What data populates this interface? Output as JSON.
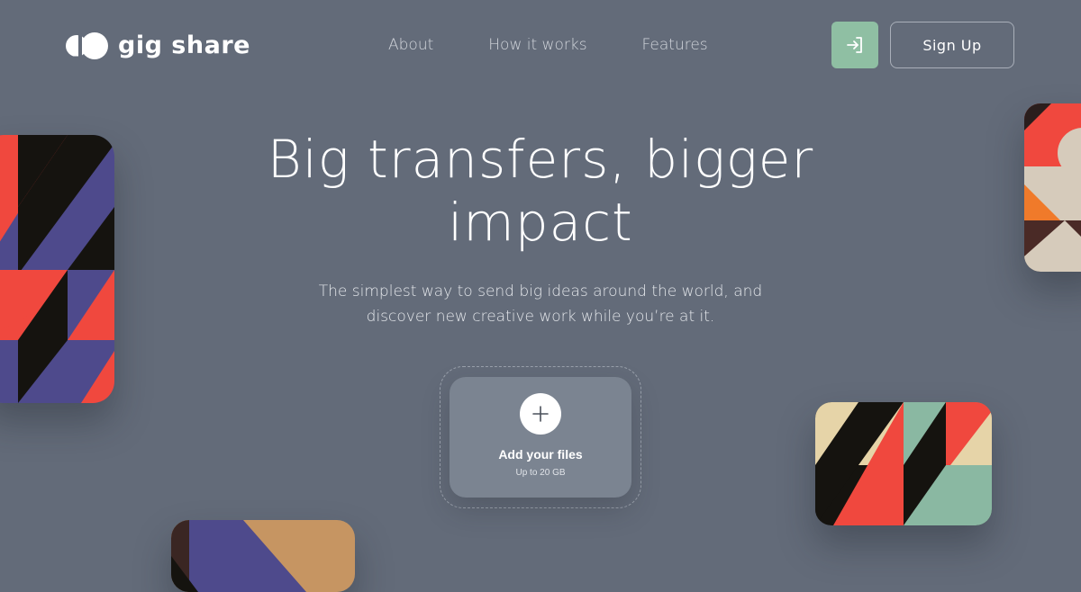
{
  "brand": {
    "name": "gig share"
  },
  "nav": {
    "items": [
      {
        "label": "About"
      },
      {
        "label": "How it works"
      },
      {
        "label": "Features"
      }
    ],
    "login_icon": "login-arrow-icon",
    "signup_label": "Sign Up"
  },
  "hero": {
    "title_line1": "Big transfers, bigger",
    "title_line2": "impact",
    "subtitle_line1": "The simplest way to send big ideas around the world, and",
    "subtitle_line2": "discover new creative work while you’re at it."
  },
  "upload": {
    "icon": "plus-icon",
    "title": "Add your files",
    "limit": "Up to 20 GB"
  },
  "colors": {
    "background": "#636b79",
    "accent_green": "#8fbfa3",
    "art_red": "#f0483e",
    "art_purple": "#4e4a8c",
    "art_black": "#15130f",
    "art_sand": "#e6d4a8",
    "art_mint": "#8ab8a2"
  }
}
